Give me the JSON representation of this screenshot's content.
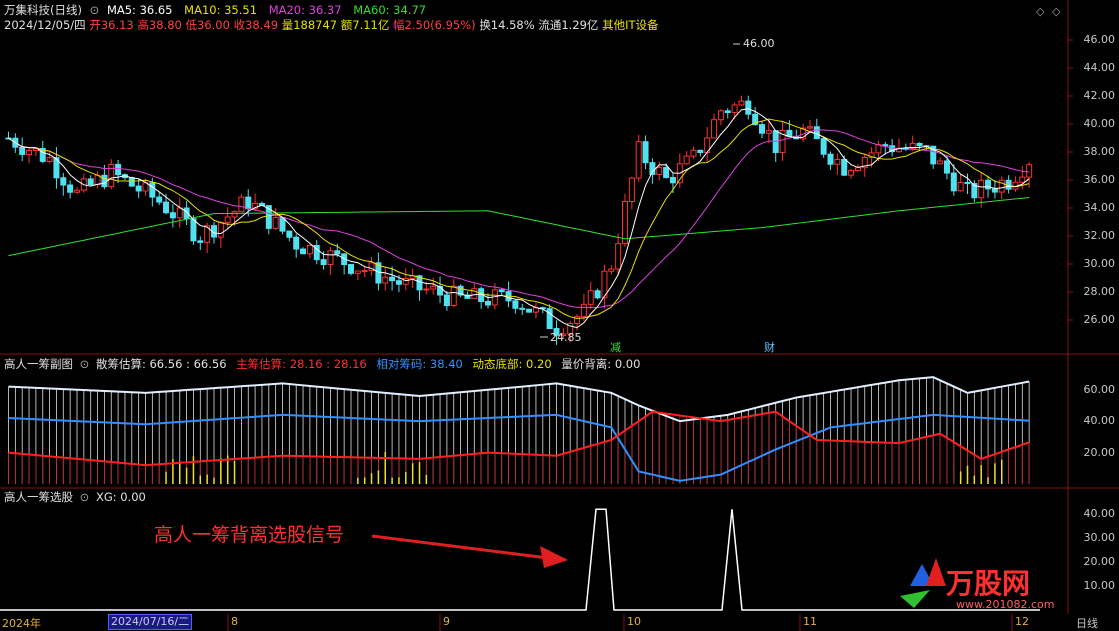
{
  "stock": {
    "name": "万集科技",
    "period": "(日线)"
  },
  "ma": [
    {
      "label": "MA5: 36.65",
      "color": "#ffffff"
    },
    {
      "label": "MA10: 35.51",
      "color": "#e8e000"
    },
    {
      "label": "MA20: 36.37",
      "color": "#e040e0"
    },
    {
      "label": "MA60: 34.77",
      "color": "#30e030"
    }
  ],
  "quote": {
    "date": "2024/12/05/四",
    "open": "开36.13",
    "high": "高38.80",
    "low": "低36.00",
    "close": "收38.49",
    "volume": "量188747",
    "amount": "额7.11亿",
    "change": "幅2.50(6.95%)",
    "turnover": "换14.58%",
    "float": "流通1.29亿",
    "sector": "其他IT设备"
  },
  "price_axis": [
    "46.00",
    "44.00",
    "42.00",
    "40.00",
    "38.00",
    "36.00",
    "34.00",
    "32.00",
    "30.00",
    "28.00",
    "26.00"
  ],
  "annotations": {
    "high": "46.00",
    "low": "24.85",
    "mark1": "减",
    "mark2": "财"
  },
  "panel2": {
    "title": "高人一筹副图",
    "item1": "散筹估算: 66.56 : 66.56",
    "item2": "主筹估算: 28.16 : 28.16",
    "item3": "相对筹码: 38.40",
    "item4": "动态底部: 0.20",
    "item5": "量价背离: 0.00",
    "axis": [
      "60.00",
      "40.00",
      "20.00"
    ]
  },
  "panel3": {
    "title": "高人一筹选股",
    "value": "XG: 0.00",
    "axis": [
      "40.00",
      "30.00",
      "20.00",
      "10.00"
    ],
    "annotation": "高人一筹背离选股信号"
  },
  "timeline": {
    "year": "2024年",
    "cursor_date": "2024/07/16/二",
    "months": [
      "8",
      "9",
      "10",
      "11",
      "12"
    ],
    "mode": "日线"
  },
  "watermark": {
    "brand": "万股网",
    "url": "www.201082.com"
  },
  "chart_data": {
    "type": "candlestick",
    "series": [
      {
        "name": "MA5"
      },
      {
        "name": "MA10"
      },
      {
        "name": "MA20"
      },
      {
        "name": "MA60"
      }
    ],
    "ylim": [
      25,
      47
    ],
    "high": 46.0,
    "low": 24.85
  }
}
